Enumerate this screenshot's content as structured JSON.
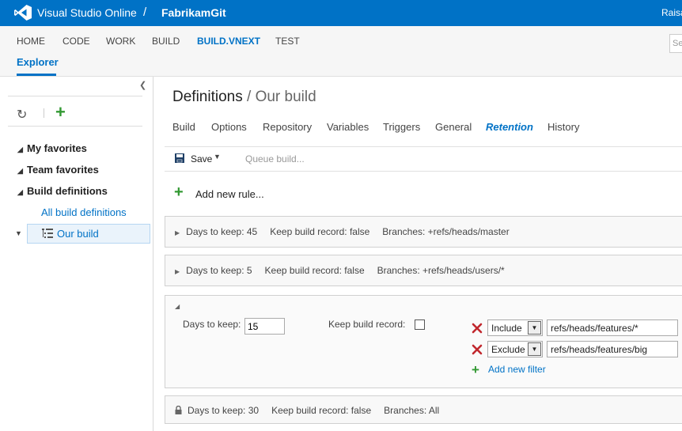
{
  "header": {
    "brand": "Visual Studio Online",
    "separator": "/",
    "project": "FabrikamGit",
    "user": "Raisa"
  },
  "nav": {
    "items": [
      "HOME",
      "CODE",
      "WORK",
      "BUILD",
      "BUILD.VNEXT",
      "TEST"
    ],
    "active": "BUILD.VNEXT",
    "subnav": "Explorer",
    "search_placeholder": "Se"
  },
  "explorer": {
    "tree": [
      {
        "label": "My favorites"
      },
      {
        "label": "Team favorites"
      },
      {
        "label": "Build definitions"
      }
    ],
    "all_link": "All build definitions",
    "selected": "Our build"
  },
  "page": {
    "title_main": "Definitions",
    "title_sep": " / ",
    "title_sub": "Our build"
  },
  "tabs": [
    "Build",
    "Options",
    "Repository",
    "Variables",
    "Triggers",
    "General",
    "Retention",
    "History"
  ],
  "active_tab": "Retention",
  "toolbar": {
    "save": "Save",
    "queue": "Queue build..."
  },
  "add_rule": "Add new rule...",
  "rules": [
    {
      "days": "Days to keep: 45",
      "keep": "Keep build record: false",
      "branches": "Branches: +refs/heads/master"
    },
    {
      "days": "Days to keep: 5",
      "keep": "Keep build record: false",
      "branches": "Branches: +refs/heads/users/*"
    }
  ],
  "expanded_rule": {
    "days_label": "Days to keep:",
    "days_value": "15",
    "keep_label": "Keep build record:",
    "keep_checked": false,
    "filters": [
      {
        "type": "Include",
        "branch": "refs/heads/features/*"
      },
      {
        "type": "Exclude",
        "branch": "refs/heads/features/big"
      }
    ],
    "add_filter": "Add new filter"
  },
  "locked_rule": {
    "days": "Days to keep: 30",
    "keep": "Keep build record: false",
    "branches": "Branches: All"
  },
  "colors": {
    "accent": "#0072c6",
    "add_green": "#339933",
    "remove_red": "#c1272d"
  }
}
